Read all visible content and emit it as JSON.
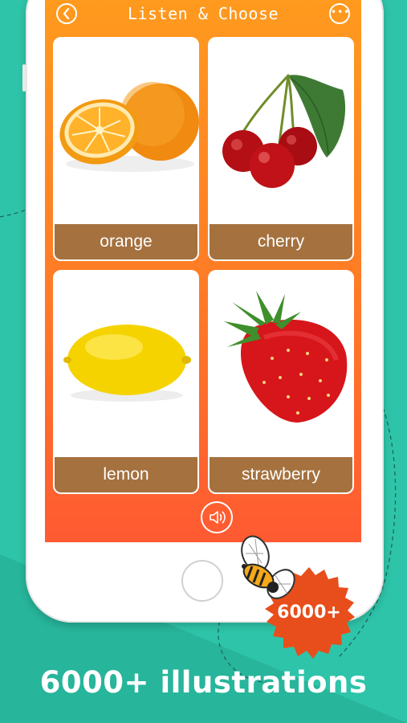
{
  "header": {
    "title": "Listen & Choose"
  },
  "cards": [
    {
      "label": "orange",
      "icon": "orange-image"
    },
    {
      "label": "cherry",
      "icon": "cherry-image"
    },
    {
      "label": "lemon",
      "icon": "lemon-image"
    },
    {
      "label": "strawberry",
      "icon": "strawberry-image"
    }
  ],
  "badge": {
    "text": "6000+"
  },
  "caption": "6000+ illustrations",
  "colors": {
    "background": "#2ec4a9",
    "screen_top": "#ff9a1e",
    "screen_bottom": "#ff5a32",
    "label_bar": "#a4713f",
    "badge": "#e84e1b"
  }
}
